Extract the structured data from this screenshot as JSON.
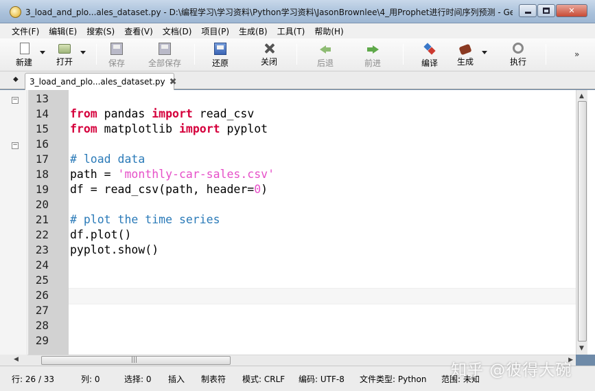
{
  "window": {
    "title": "3_load_and_plo...ales_dataset.py - D:\\编程学习\\学习资料\\Python学习资料\\JasonBrownlee\\4_用Prophet进行时间序列预测 - Ge...",
    "minimize_icon": "minimize-icon",
    "maximize_icon": "maximize-icon",
    "close_label": "✕"
  },
  "menu": [
    {
      "label": "文件(F)"
    },
    {
      "label": "编辑(E)"
    },
    {
      "label": "搜索(S)"
    },
    {
      "label": "查看(V)"
    },
    {
      "label": "文档(D)"
    },
    {
      "label": "项目(P)"
    },
    {
      "label": "生成(B)"
    },
    {
      "label": "工具(T)"
    },
    {
      "label": "帮助(H)"
    }
  ],
  "toolbar": {
    "new": "新建",
    "open": "打开",
    "save": "保存",
    "save_all": "全部保存",
    "revert": "还原",
    "close": "关闭",
    "back": "后退",
    "forward": "前进",
    "compile": "编译",
    "build": "生成",
    "execute": "执行",
    "more": "»"
  },
  "tab": {
    "label": "3_load_and_plo...ales_dataset.py",
    "close_icon": "close-tab-icon"
  },
  "editor": {
    "line_numbers": [
      "13",
      "14",
      "15",
      "16",
      "17",
      "18",
      "19",
      "20",
      "21",
      "22",
      "23",
      "24",
      "25",
      "26",
      "27",
      "28",
      "29"
    ],
    "current_line": 26,
    "code": {
      "l14_kw1": "from",
      "l14_mid": " pandas ",
      "l14_kw2": "import",
      "l14_end": " read_csv",
      "l15_kw1": "from",
      "l15_mid": " matplotlib ",
      "l15_kw2": "import",
      "l15_end": " pyplot",
      "l17_comment": "# load data",
      "l18_pre": "path = ",
      "l18_str": "'monthly-car-sales.csv'",
      "l19_pre": "df = read_csv(path, header=",
      "l19_num": "0",
      "l19_post": ")",
      "l21_comment": "# plot the time series",
      "l22": "df.plot()",
      "l23": "pyplot.show()"
    }
  },
  "statusbar": {
    "line": "行: 26 / 33",
    "col": "列: 0",
    "sel": "选择: 0",
    "ins": "插入",
    "tab": "制表符",
    "mode": "模式: CRLF",
    "encoding": "编码: UTF-8",
    "filetype": "文件类型: Python",
    "scope": "范围: 未知"
  },
  "watermark": "知乎 @彼得大碗",
  "colors": {
    "keyword": "#d5003c",
    "comment": "#2a7ab8",
    "string": "#e64fc8"
  }
}
